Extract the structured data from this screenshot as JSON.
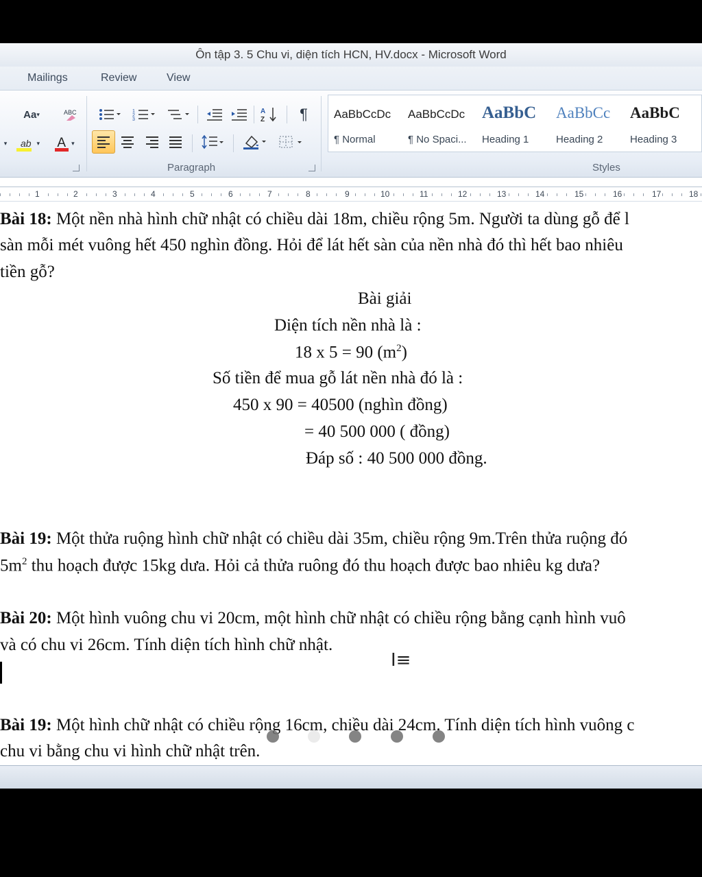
{
  "window": {
    "title": "Ôn tập 3. 5 Chu vi, diện tích HCN, HV.docx  -  Microsoft Word"
  },
  "tabs": [
    "Mailings",
    "Review",
    "View"
  ],
  "ribbon": {
    "font_size_btn": "Aa",
    "highlight_btn": "ab",
    "font_color_btn": "A",
    "paragraph_label": "Paragraph",
    "styles_label": "Styles",
    "pilcrow": "¶",
    "styles": [
      {
        "sample": "AaBbCcDc",
        "name": "¶ Normal"
      },
      {
        "sample": "AaBbCcDc",
        "name": "¶ No Spaci..."
      },
      {
        "sample": "AaBbC",
        "name": "Heading 1"
      },
      {
        "sample": "AaBbCc",
        "name": "Heading 2"
      },
      {
        "sample": "AaBbC",
        "name": "Heading 3"
      }
    ]
  },
  "ruler": {
    "numbers": [
      "1",
      "2",
      "3",
      "4",
      "5",
      "6",
      "7",
      "8",
      "9",
      "10",
      "11",
      "12",
      "13",
      "14",
      "15",
      "16",
      "17",
      "18"
    ]
  },
  "doc": {
    "b18_label": "Bài 18:",
    "b18_l1": " Một nền nhà hình chữ nhật có chiều dài 18m, chiều rộng 5m. Người ta dùng gỗ để l",
    "b18_l2": "sàn mỗi mét vuông hết 450 nghìn đồng. Hỏi để lát hết sàn của nền nhà đó thì hết bao nhiêu",
    "b18_l3": "tiền gỗ?",
    "sol_title": "Bài giải",
    "sol_1": "Diện tích nền nhà là :",
    "sol_2a": "18 x 5 = 90 (m",
    "sol_2sup": "2",
    "sol_2b": ")",
    "sol_3": "Số tiền để mua gỗ lát nền nhà đó là :",
    "sol_4": "450 x 90 = 40500 (nghìn đồng)",
    "sol_5": "= 40 500 000 ( đồng)",
    "sol_6": "Đáp số : 40 500 000 đồng.",
    "b19_label": "Bài 19:",
    "b19_l1": " Một thửa ruộng hình chữ nhật có chiều dài 35m, chiều rộng 9m.Trên thửa ruộng đó",
    "b19_l2a": "5m",
    "b19_l2sup": "2",
    "b19_l2b": " thu hoạch được 15kg dưa. Hỏi cả thửa ruông đó thu hoạch được bao nhiêu kg dưa?",
    "b20_label": "Bài 20:",
    "b20_l1": " Một hình vuông chu vi 20cm, một hình chữ nhật có chiều rộng bằng cạnh hình vuô",
    "b20_l2": "và có  chu vi 26cm. Tính diện tích hình chữ nhật.",
    "b19b_label": "Bài 19:",
    "b19b_l1": " Một hình chữ nhật có chiều rộng 16cm, chiều dài 24cm. Tính diện tích hình vuông c",
    "b19b_l2": "chu vi bằng chu vi hình chữ nhật trên."
  }
}
